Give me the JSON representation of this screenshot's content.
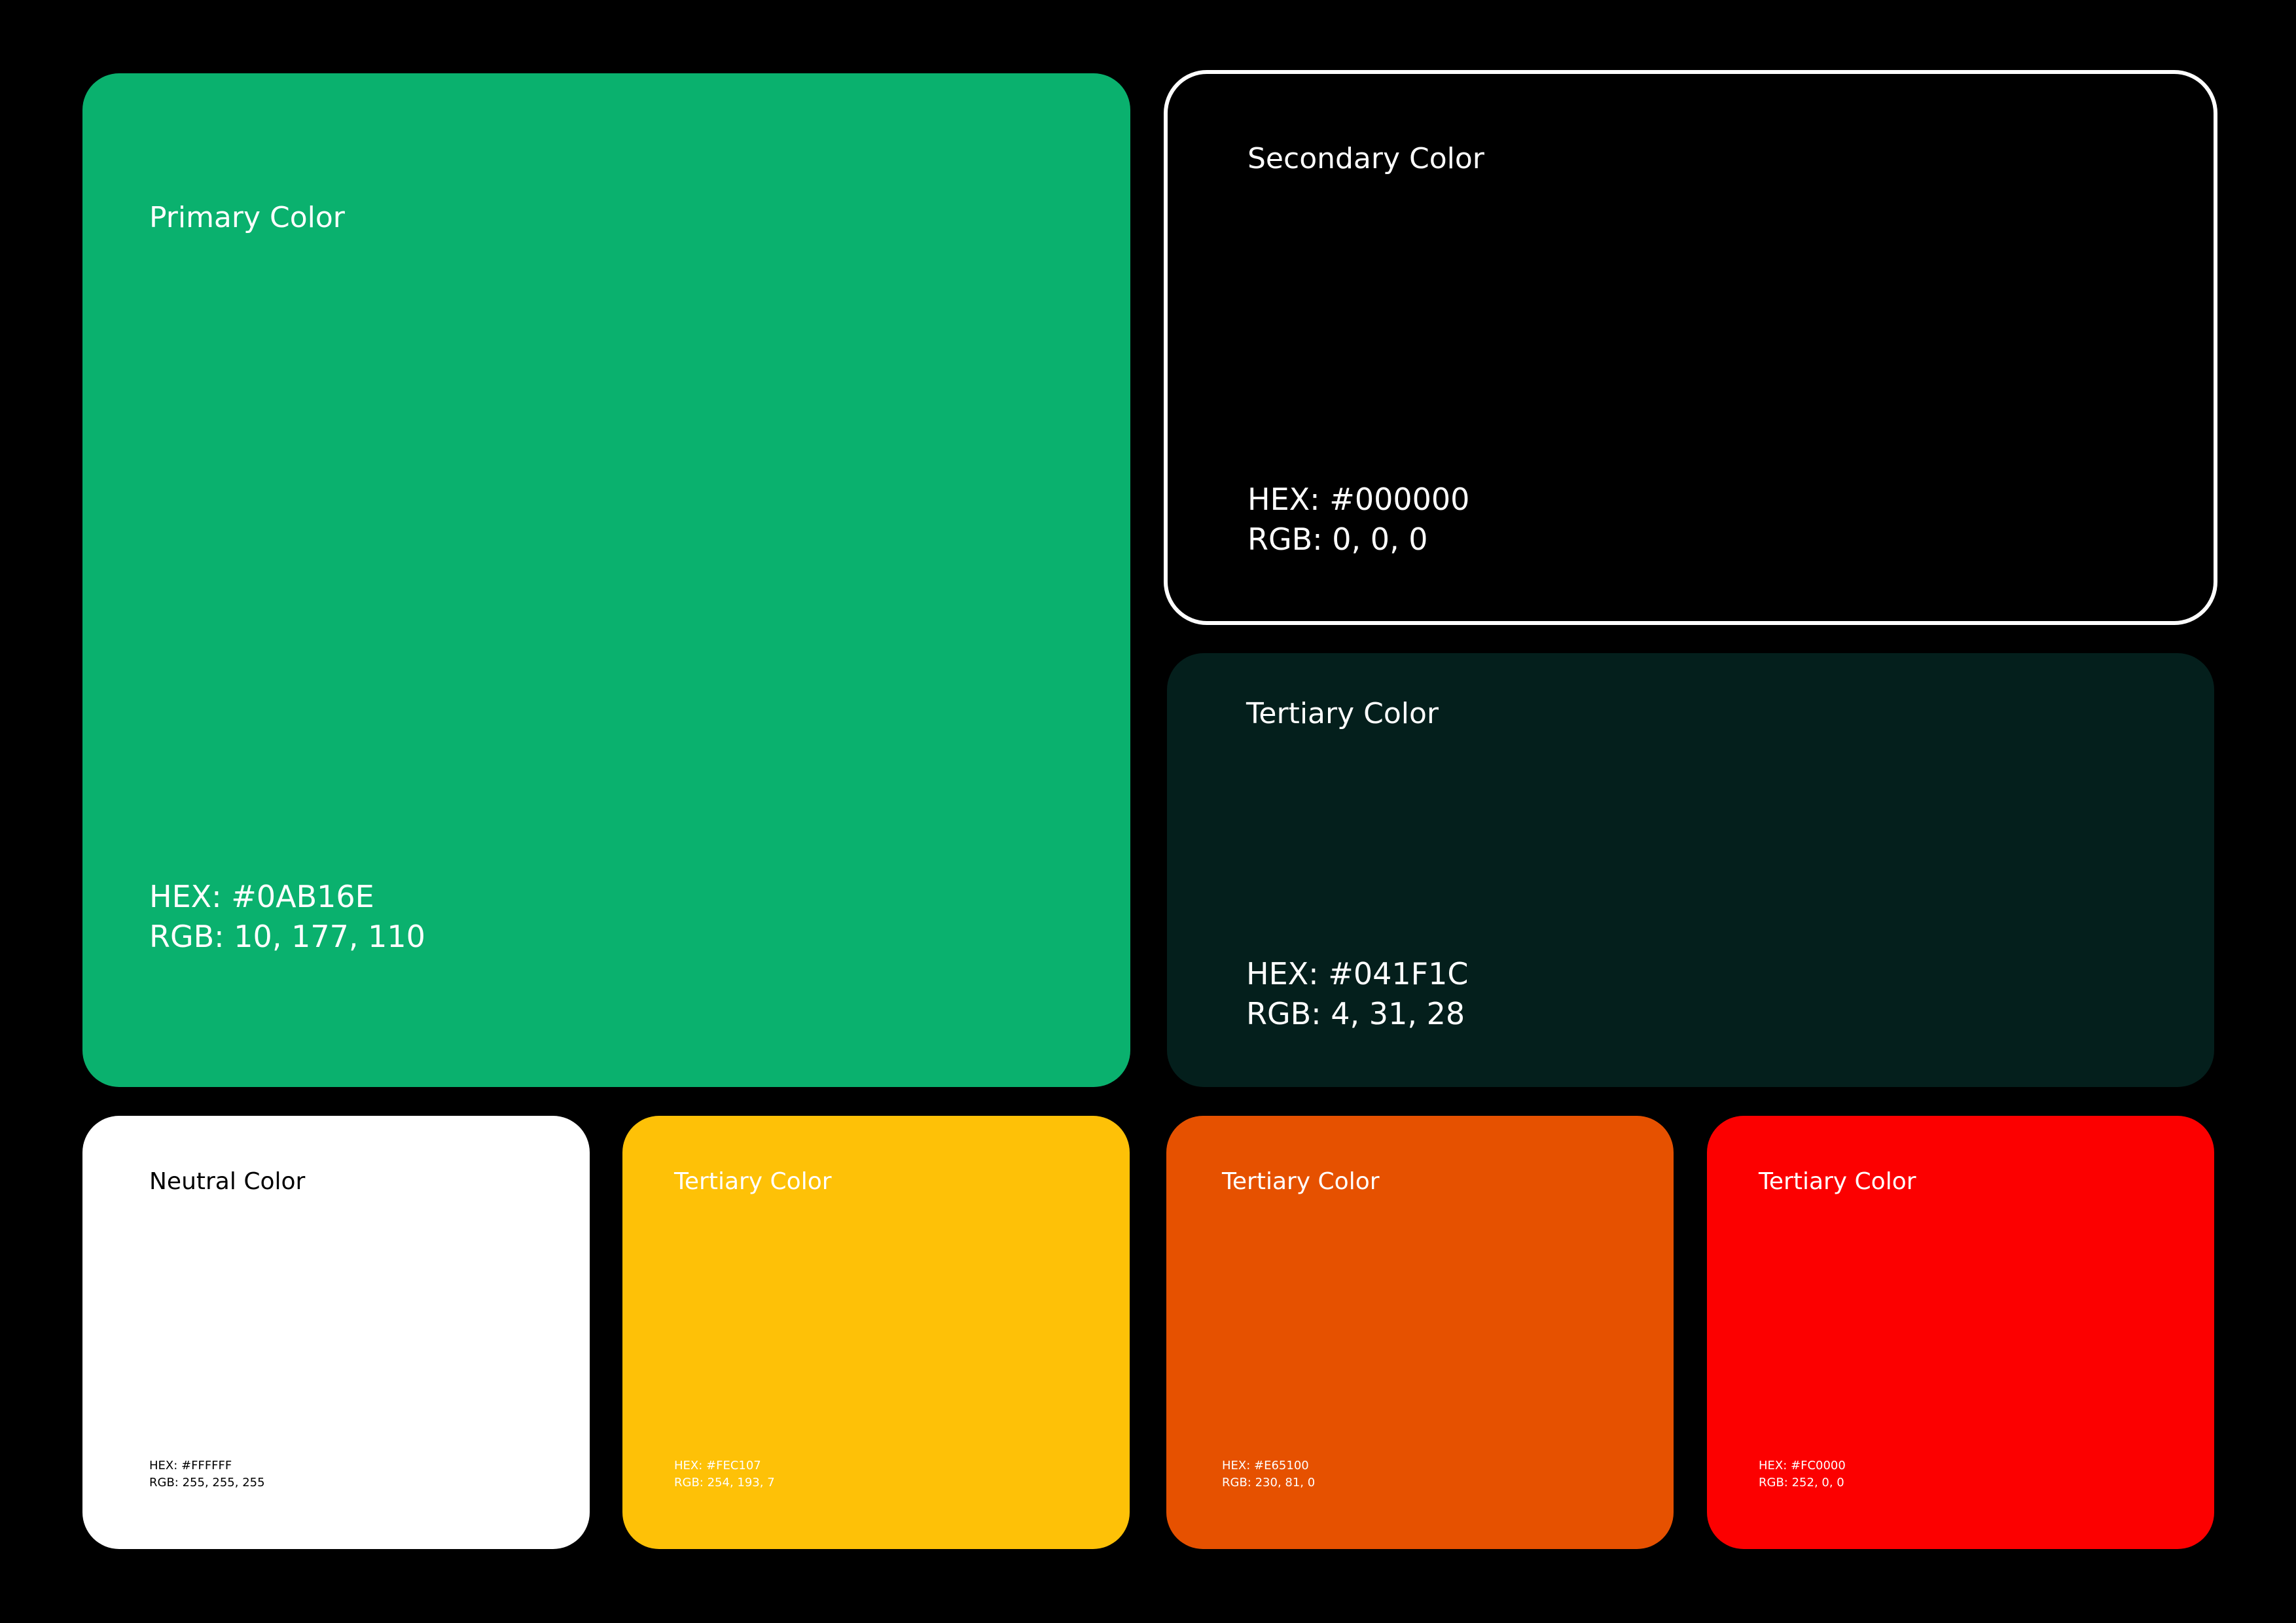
{
  "swatches": {
    "primary": {
      "title": "Primary Color",
      "hex": "HEX: #0AB16E",
      "rgb": "RGB: 10, 177, 110",
      "color": "#0AB16E"
    },
    "secondary": {
      "title": "Secondary Color",
      "hex": "HEX: #000000",
      "rgb": "RGB: 0, 0, 0",
      "color": "#000000",
      "border_color": "#FFFFFF"
    },
    "tertiary_dark": {
      "title": "Tertiary Color",
      "hex": "HEX: #041F1C",
      "rgb": "RGB: 4, 31, 28",
      "color": "#041F1C"
    },
    "neutral": {
      "title": "Neutral Color",
      "hex": "HEX: #FFFFFF",
      "rgb": "RGB: 255, 255, 255",
      "color": "#FFFFFF"
    },
    "tertiary_yellow": {
      "title": "Tertiary Color",
      "hex": "HEX: #FEC107",
      "rgb": "RGB: 254, 193, 7",
      "color": "#FEC107"
    },
    "tertiary_orange": {
      "title": "Tertiary Color",
      "hex": "HEX: #E65100",
      "rgb": "RGB: 230, 81, 0",
      "color": "#E65100"
    },
    "tertiary_red": {
      "title": "Tertiary Color",
      "hex": "HEX: #FC0000",
      "rgb": "RGB: 252, 0, 0",
      "color": "#FC0000"
    }
  },
  "background_color": "#000000"
}
